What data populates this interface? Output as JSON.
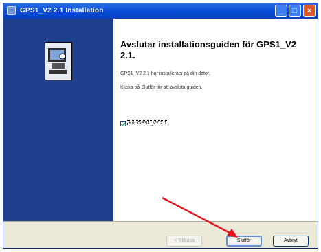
{
  "window": {
    "title": "GPS1_V2 2.1 Installation",
    "controls": {
      "minimize": "_",
      "maximize": "□",
      "close": "×"
    }
  },
  "content": {
    "heading": "Avslutar installationsguiden för GPS1_V2 2.1.",
    "message_installed": "GPS1_V2 2.1 har installerats på din dator.",
    "message_finish": "Klicka på Slutför för att avsluta guiden.",
    "checkbox_label": "Kör GPS1_V2 2.1",
    "checkbox_checked": true
  },
  "footer": {
    "back_label": "< Tillbaka",
    "finish_label": "Slutför",
    "cancel_label": "Avbryt"
  },
  "colors": {
    "titlebar": "#0a4fd6",
    "side_panel": "#1d3f8c",
    "arrow": "#e8141c"
  }
}
